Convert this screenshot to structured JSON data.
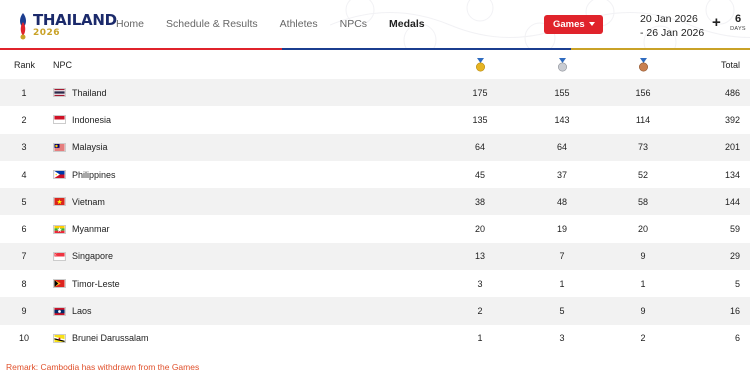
{
  "brand": {
    "name": "THAILAND",
    "year": "2026"
  },
  "nav": {
    "items": [
      "Home",
      "Schedule & Results",
      "Athletes",
      "NPCs",
      "Medals"
    ],
    "active_index": 4
  },
  "games_button": {
    "label": "Games"
  },
  "dates": {
    "start": "20 Jan 2026",
    "end": "- 26 Jan 2026"
  },
  "countdown": {
    "prefix": "+",
    "value": "6",
    "unit": "DAYS"
  },
  "colors": {
    "accent_red": "#e0232b",
    "stripe": [
      "#e0232b",
      "#1b3d8f",
      "#c9a227"
    ],
    "remark": "#e0502b"
  },
  "table": {
    "headers": {
      "rank": "Rank",
      "npc": "NPC",
      "gold_icon": "gold-medal-icon",
      "silver_icon": "silver-medal-icon",
      "bronze_icon": "bronze-medal-icon",
      "total": "Total"
    },
    "rows": [
      {
        "rank": "1",
        "npc": "Thailand",
        "gold": "175",
        "silver": "155",
        "bronze": "156",
        "total": "486"
      },
      {
        "rank": "2",
        "npc": "Indonesia",
        "gold": "135",
        "silver": "143",
        "bronze": "114",
        "total": "392"
      },
      {
        "rank": "3",
        "npc": "Malaysia",
        "gold": "64",
        "silver": "64",
        "bronze": "73",
        "total": "201"
      },
      {
        "rank": "4",
        "npc": "Philippines",
        "gold": "45",
        "silver": "37",
        "bronze": "52",
        "total": "134"
      },
      {
        "rank": "5",
        "npc": "Vietnam",
        "gold": "38",
        "silver": "48",
        "bronze": "58",
        "total": "144"
      },
      {
        "rank": "6",
        "npc": "Myanmar",
        "gold": "20",
        "silver": "19",
        "bronze": "20",
        "total": "59"
      },
      {
        "rank": "7",
        "npc": "Singapore",
        "gold": "13",
        "silver": "7",
        "bronze": "9",
        "total": "29"
      },
      {
        "rank": "8",
        "npc": "Timor-Leste",
        "gold": "3",
        "silver": "1",
        "bronze": "1",
        "total": "5"
      },
      {
        "rank": "9",
        "npc": "Laos",
        "gold": "2",
        "silver": "5",
        "bronze": "9",
        "total": "16"
      },
      {
        "rank": "10",
        "npc": "Brunei Darussalam",
        "gold": "1",
        "silver": "3",
        "bronze": "2",
        "total": "6"
      }
    ]
  },
  "remark": "Remark: Cambodia has withdrawn from the Games"
}
